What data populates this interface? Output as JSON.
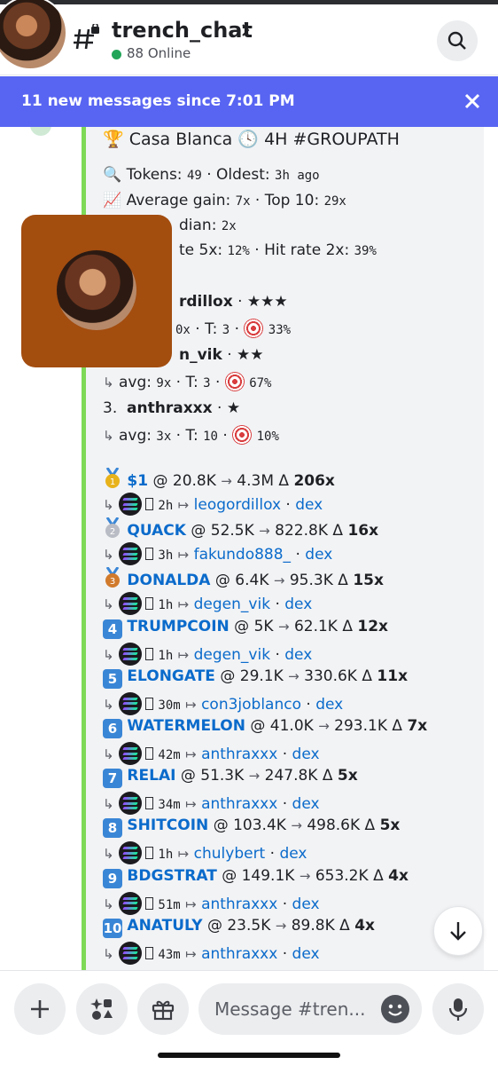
{
  "header": {
    "channel_name": "trench_chat",
    "online_count": "88 Online"
  },
  "banner": {
    "text": "11 new messages since 7:01 PM"
  },
  "embed": {
    "title": "Casa Blanca",
    "title_suffix": "4H #GROUPATH",
    "tokens_label": "Tokens:",
    "tokens_value": "49",
    "oldest_label": "Oldest:",
    "oldest_value": "3h ago",
    "avg_gain_label": "Average gain:",
    "avg_gain_value": "7x",
    "top10_label": "Top 10:",
    "top10_value": "29x",
    "median_label": "dian:",
    "median_value": "2x",
    "hit5_label": "te 5x:",
    "hit5_value": "12%",
    "hit2_label": "Hit rate 2x:",
    "hit2_value": "39%",
    "leaders": [
      {
        "name": "rdillox",
        "stars": "★★★",
        "avg": "0x",
        "t_label": "T:",
        "t_value": "3",
        "pct": "33%"
      },
      {
        "name": "n_vik",
        "stars": "★★",
        "avg_label": "avg:",
        "avg": "9x",
        "t_label": "T:",
        "t_value": "3",
        "pct": "67%"
      },
      {
        "rank": "3.",
        "name": "anthraxxx",
        "stars": "★",
        "avg_label": "avg:",
        "avg": "3x",
        "t_label": "T:",
        "t_value": "10",
        "pct": "10%"
      }
    ],
    "calls": [
      {
        "rank": "1",
        "token": "$1",
        "entry": "@ 20.8K",
        "exit": "4.3M",
        "mult": "206x",
        "age": "2h",
        "caller": "leogordillox",
        "dex": "dex"
      },
      {
        "rank": "2",
        "token": "QUACK",
        "entry": "@ 52.5K",
        "exit": "822.8K",
        "mult": "16x",
        "age": "3h",
        "caller": "fakundo888_",
        "dex": "dex"
      },
      {
        "rank": "3",
        "token": "DONALDA",
        "entry": "@ 6.4K",
        "exit": "95.3K",
        "mult": "15x",
        "age": "1h",
        "caller": "degen_vik",
        "dex": "dex"
      },
      {
        "rank": "4",
        "token": "TRUMPCOIN",
        "entry": "@ 5K",
        "exit": "62.1K",
        "mult": "12x",
        "age": "1h",
        "caller": "degen_vik",
        "dex": "dex"
      },
      {
        "rank": "5",
        "token": "ELONGATE",
        "entry": "@ 29.1K",
        "exit": "330.6K",
        "mult": "11x",
        "age": "30m",
        "caller": "con3joblanco",
        "dex": "dex"
      },
      {
        "rank": "6",
        "token": "WATERMELON",
        "entry": "@ 41.0K",
        "exit": "293.1K",
        "mult": "7x",
        "age": "42m",
        "caller": "anthraxxx",
        "dex": "dex"
      },
      {
        "rank": "7",
        "token": "RELAI",
        "entry": "@ 51.3K",
        "exit": "247.8K",
        "mult": "5x",
        "age": "34m",
        "caller": "anthraxxx",
        "dex": "dex"
      },
      {
        "rank": "8",
        "token": "SHITCOIN",
        "entry": "@ 103.4K",
        "exit": "498.6K",
        "mult": "5x",
        "age": "1h",
        "caller": "chulybert",
        "dex": "dex"
      },
      {
        "rank": "9",
        "token": "BDGSTRAT",
        "entry": "@ 149.1K",
        "exit": "653.2K",
        "mult": "4x",
        "age": "51m",
        "caller": "anthraxxx",
        "dex": "dex"
      },
      {
        "rank": "10",
        "token": "ANATULY",
        "entry": "@ 23.5K",
        "exit": "89.8K",
        "mult": "4x",
        "age": "43m",
        "caller": "anthraxxx",
        "dex": "dex"
      }
    ]
  },
  "composer": {
    "placeholder": "Message #tren..."
  },
  "colors": {
    "accent": "#5865f2",
    "embed_border": "#7ed957",
    "link": "#0b6bcb",
    "online": "#23a559"
  }
}
